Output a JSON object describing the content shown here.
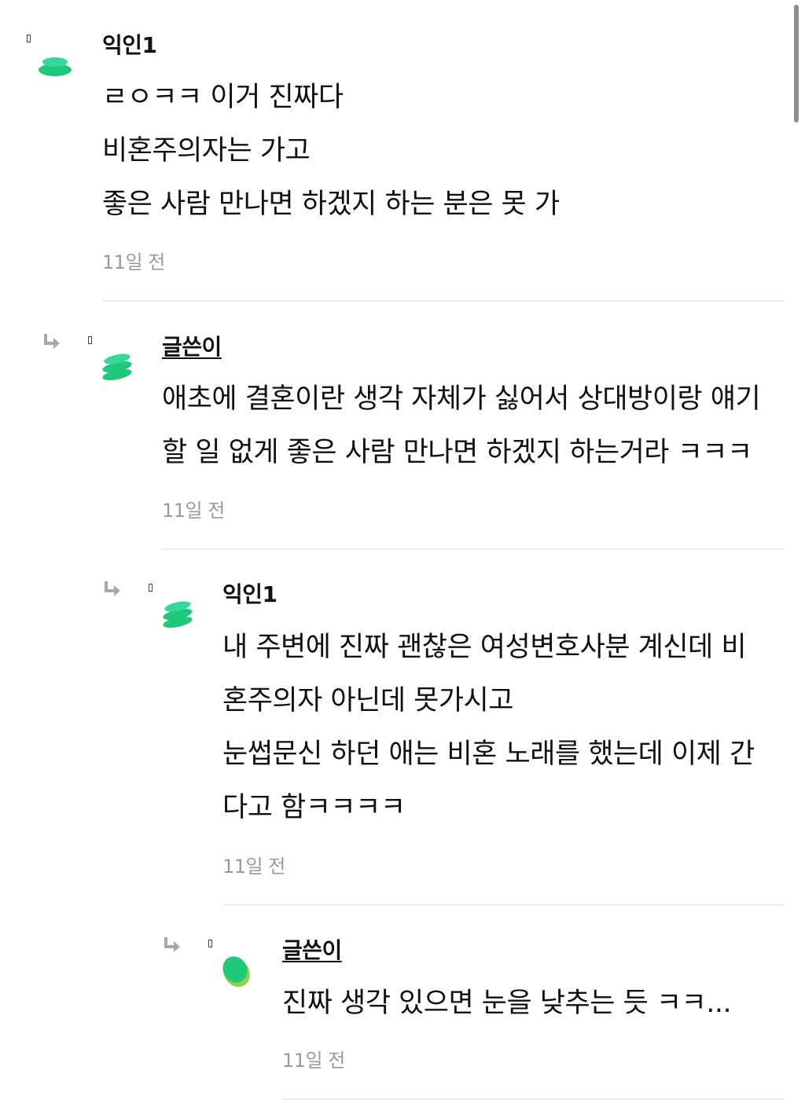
{
  "comments": [
    {
      "author": "익인1",
      "is_op": false,
      "lines": [
        "ㄹㅇㅋㅋ 이거 진짜다",
        "비혼주의자는 가고",
        "좋은 사람 만나면 하겠지 하는 분은 못 가"
      ],
      "time": "11일 전",
      "avatar_icon": "green-stack-avatar-icon"
    },
    {
      "author": "글쓴이",
      "is_op": true,
      "lines": [
        "애초에 결혼이란 생각 자체가 싫어서 상대방이랑 얘기",
        "할 일 없게 좋은 사람 만나면 하겠지 하는거라 ㅋㅋㅋ"
      ],
      "time": "11일 전",
      "avatar_icon": "green-stack-avatar-icon"
    },
    {
      "author": "익인1",
      "is_op": false,
      "lines": [
        "내 주변에 진짜 괜찮은 여성변호사분 계신데 비",
        "혼주의자 아닌데 못가시고",
        "눈썹문신 하던 애는 비혼 노래를 했는데 이제 간",
        "다고 함ㅋㅋㅋㅋ"
      ],
      "time": "11일 전",
      "avatar_icon": "green-stack-avatar-icon"
    },
    {
      "author": "글쓴이",
      "is_op": true,
      "lines": [
        "진짜 생각 있으면 눈을 낮추는 듯 ㅋㅋ..."
      ],
      "time": "11일 전",
      "avatar_icon": "green-blob-avatar-icon"
    }
  ],
  "colors": {
    "avatar_green": "#1fc97a",
    "avatar_light": "#34d89a",
    "avatar_lime": "#8fd14f",
    "time_gray": "#9a9a9a",
    "divider": "#ececec"
  },
  "icons": {
    "reply": "reply-arrow-icon",
    "mark": "placeholder-glyph-icon"
  }
}
